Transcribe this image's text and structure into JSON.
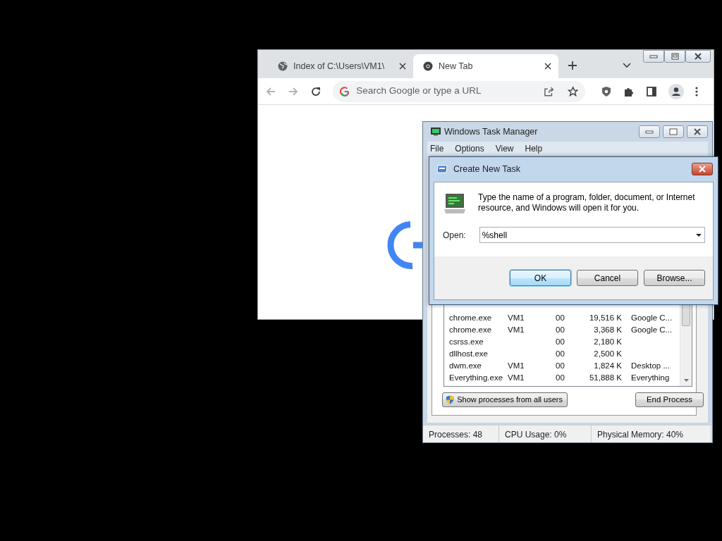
{
  "browser": {
    "tabs": [
      {
        "title": "Index of C:\\Users\\VM1\\",
        "selected": false
      },
      {
        "title": "New Tab",
        "selected": true
      }
    ],
    "omnibox": {
      "placeholder": "Search Google or type a URL"
    }
  },
  "task_manager": {
    "title": "Windows Task Manager",
    "menu": [
      "File",
      "Options",
      "View",
      "Help"
    ],
    "processes": [
      {
        "image": "chrome.exe",
        "user": "VM1",
        "cpu": "00",
        "memory": "19,516 K",
        "description": "Google C..."
      },
      {
        "image": "chrome.exe",
        "user": "VM1",
        "cpu": "00",
        "memory": "3,368 K",
        "description": "Google C..."
      },
      {
        "image": "csrss.exe",
        "cpu": "00",
        "memory": "2,180 K"
      },
      {
        "image": "dllhost.exe",
        "cpu": "00",
        "memory": "2,500 K"
      },
      {
        "image": "dwm.exe",
        "user": "VM1",
        "cpu": "00",
        "memory": "1,824 K",
        "description": "Desktop ..."
      },
      {
        "image": "Everything.exe",
        "user": "VM1",
        "cpu": "00",
        "memory": "51,888 K",
        "description": "Everything"
      }
    ],
    "show_all_button": "Show processes from all users",
    "end_button": "End Process",
    "status_bar": [
      "Processes: 48",
      "CPU Usage: 0%",
      "Physical Memory: 40%"
    ]
  },
  "dialog": {
    "title": "Create New Task",
    "message": "Type the name of a program, folder, document, or Internet resource, and Windows will open it for you.",
    "open_label": "Open:",
    "value": "%shell",
    "buttons": [
      {
        "label": "OK",
        "default": true
      },
      {
        "label": "Cancel",
        "default": false
      },
      {
        "label": "Browse...",
        "default": false
      }
    ]
  }
}
